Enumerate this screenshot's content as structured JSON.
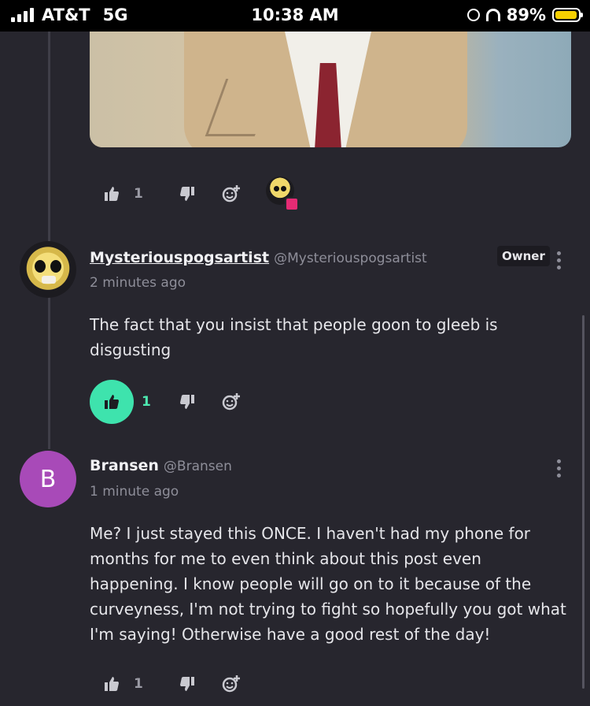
{
  "status_bar": {
    "carrier": "AT&T",
    "network": "5G",
    "time": "10:38 AM",
    "battery": "89%",
    "battery_color": "#f5cf00"
  },
  "post": {
    "image_alt": "gif-image",
    "reactions": {
      "like_count": "1",
      "like_icon": "thumbs-up-icon",
      "dislike_icon": "thumbs-down-icon",
      "react_icon": "add-reaction-icon"
    }
  },
  "comments": [
    {
      "username": "Mysteriouspogsartist",
      "handle": "@Mysteriouspogsartist",
      "badge": "Owner",
      "time": "2 minutes ago",
      "text": "The fact that you insist that people goon to gleeb is disgusting",
      "like_count": "1",
      "liked": true,
      "like_color": "#3ee3ad"
    },
    {
      "username": "Bransen",
      "handle": "@Bransen",
      "avatar_letter": "B",
      "avatar_color": "#a84ab8",
      "time": "1 minute ago",
      "text": "Me? I just stayed this ONCE. I haven't had my phone for months for me to even think about this post even happening. I know people will go on to it because of the curveyness, I'm not trying to fight so hopefully you got what I'm saying! Otherwise have a good rest of the day!",
      "like_count": "1"
    }
  ]
}
